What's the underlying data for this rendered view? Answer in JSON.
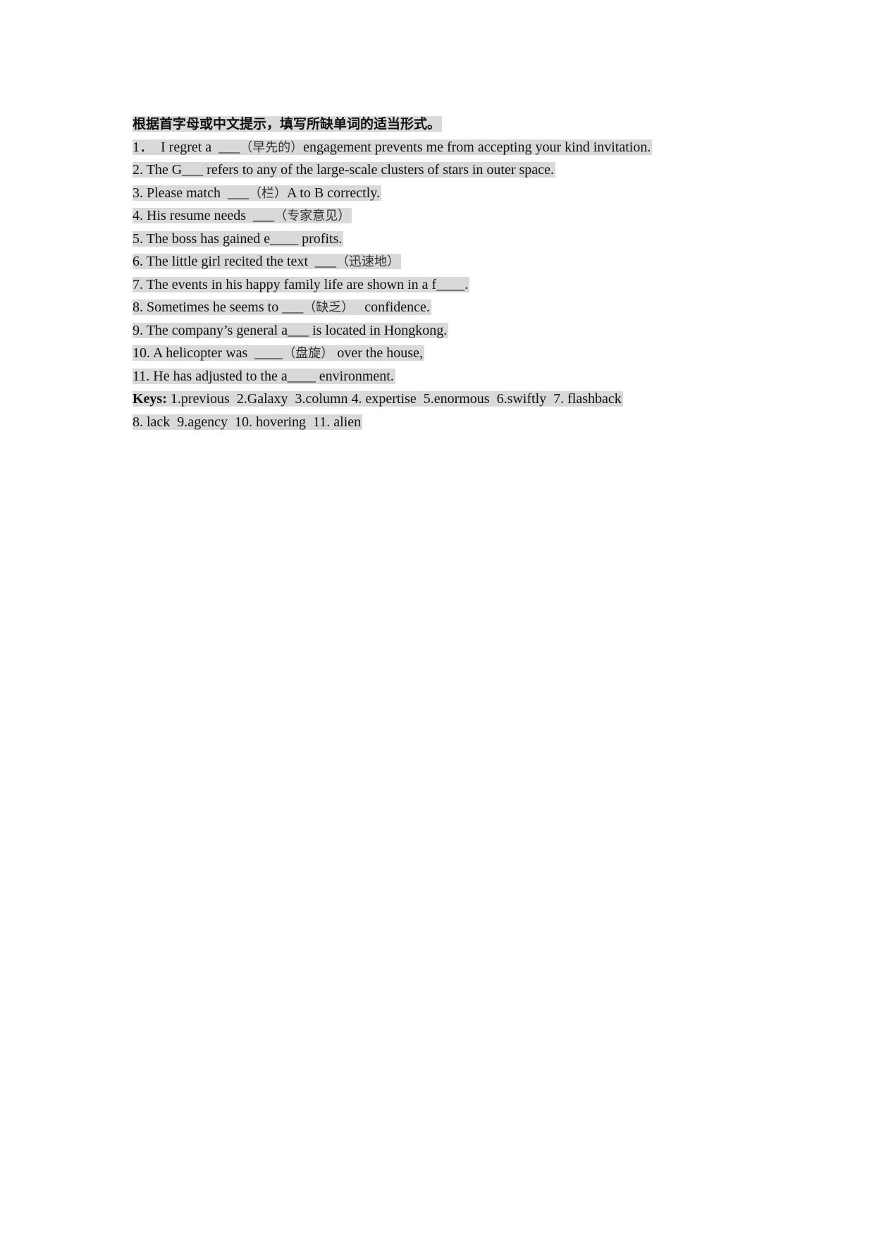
{
  "document": {
    "instruction": "根据首字母或中文提示，填写所缺单词的适当形式。",
    "questions": [
      {
        "pre": "1．  I regret a  ___",
        "hint": "（早先的）",
        "post": "engagement prevents me from accepting your kind invitation."
      },
      {
        "pre": "2. The G___ refers to any of the large-scale clusters of stars in outer space.",
        "hint": "",
        "post": ""
      },
      {
        "pre": "3. Please match  ___",
        "hint": "（栏）",
        "post": "A to B correctly."
      },
      {
        "pre": "4. His resume needs  ___",
        "hint": "（专家意见）",
        "post": ""
      },
      {
        "pre": "5. The boss has gained e____ profits.",
        "hint": "",
        "post": ""
      },
      {
        "pre": "6. The little girl recited the text  ___",
        "hint": "（迅速地）",
        "post": ""
      },
      {
        "pre": "7. The events in his happy family life are shown in a f____.",
        "hint": "",
        "post": ""
      },
      {
        "pre": "8. Sometimes he seems to ___",
        "hint": "（缺乏）",
        "post": "   confidence."
      },
      {
        "pre": "9. The company’s general a___ is located in Hongkong.",
        "hint": "",
        "post": ""
      },
      {
        "pre": "10. A helicopter was  ____",
        "hint": "（盘旋）",
        "post": " over the house,"
      },
      {
        "pre": "11. He has adjusted to the a____ environment.",
        "hint": "",
        "post": ""
      }
    ],
    "keys_label": "Keys:",
    "keys_line1": " 1.previous  2.Galaxy  3.column 4. expertise  5.enormous  6.swiftly  7. flashback",
    "keys_line2": "8. lack  9.agency  10. hovering  11. alien"
  }
}
